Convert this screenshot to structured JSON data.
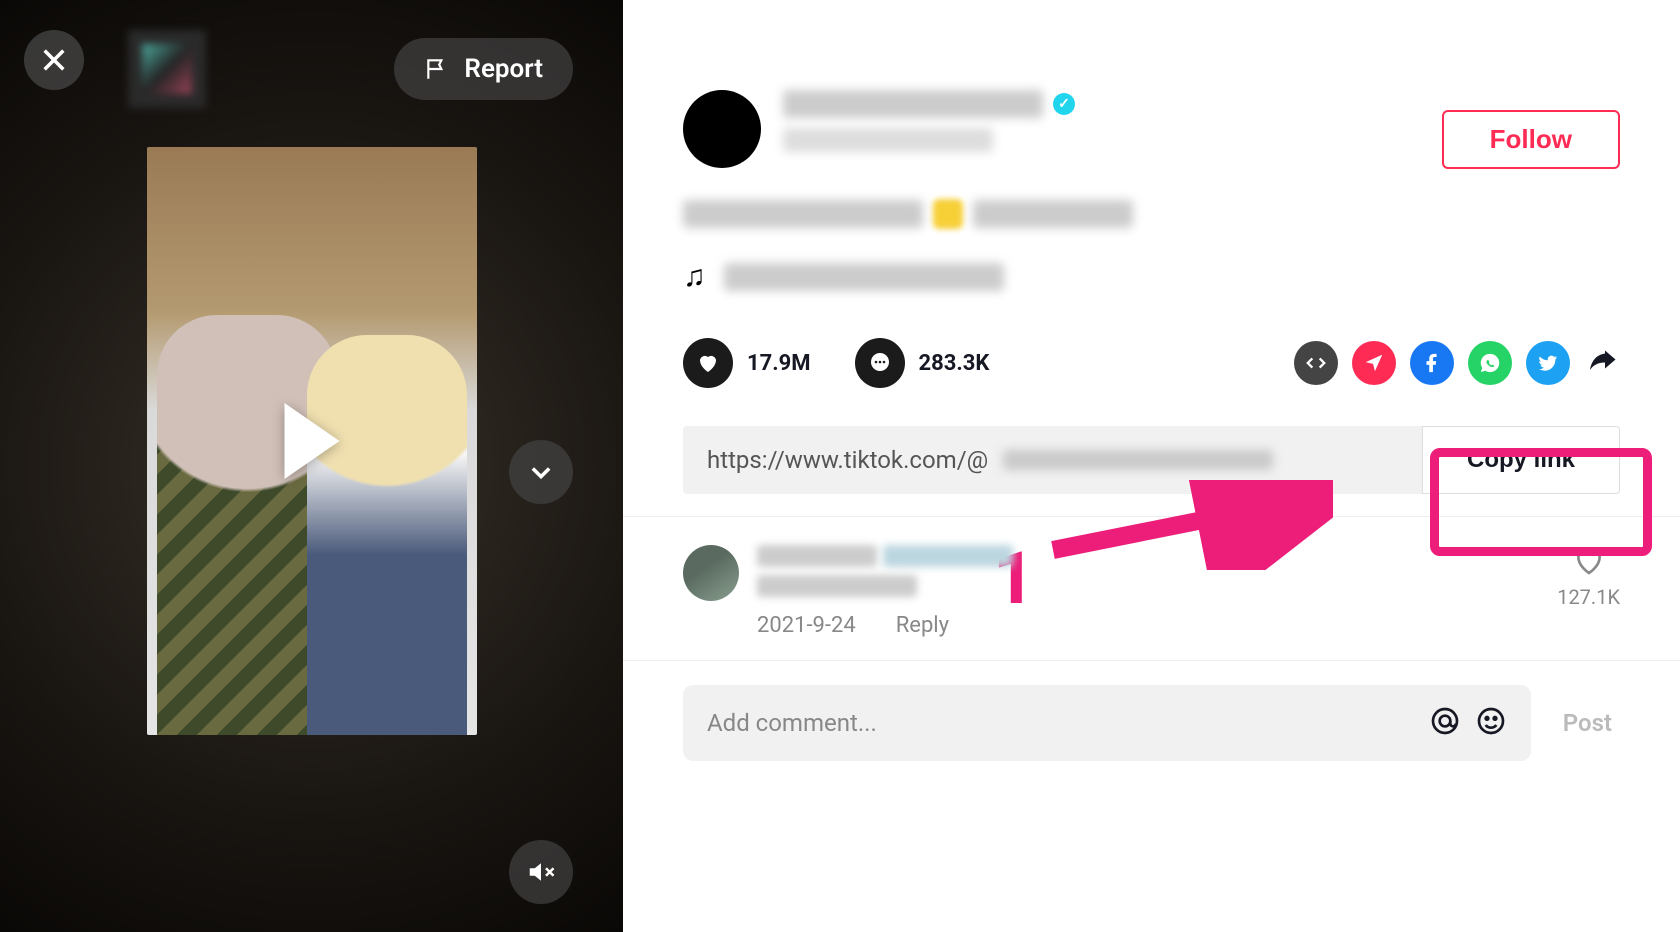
{
  "video": {
    "report_label": "Report"
  },
  "profile": {
    "follow_label": "Follow"
  },
  "stats": {
    "likes": "17.9M",
    "comments": "283.3K"
  },
  "link": {
    "url_visible": "https://www.tiktok.com/@",
    "copy_label": "Copy link"
  },
  "annotation": {
    "number": "1"
  },
  "comment": {
    "date": "2021-9-24",
    "reply_label": "Reply",
    "likes": "127.1K"
  },
  "composer": {
    "placeholder": "Add comment...",
    "post_label": "Post"
  }
}
